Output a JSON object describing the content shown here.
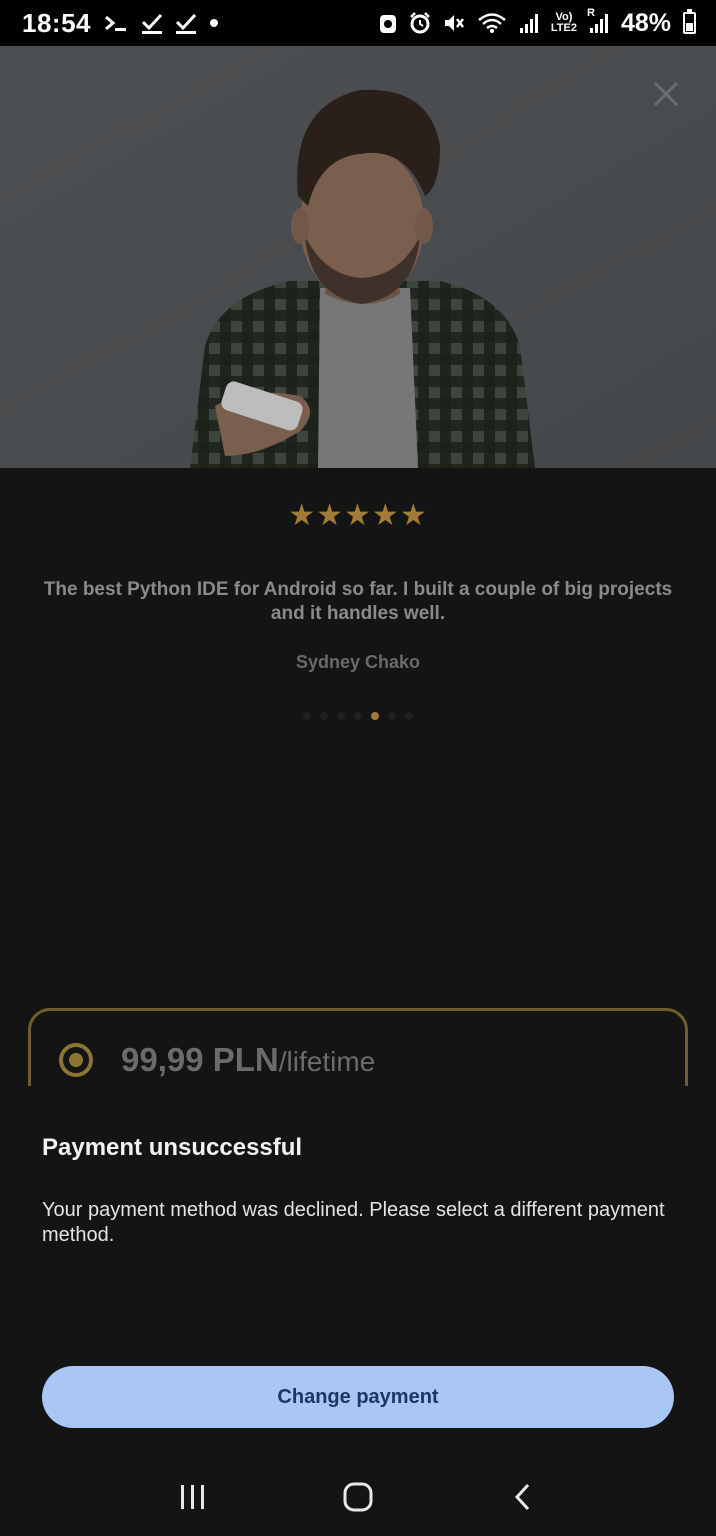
{
  "status_bar": {
    "time": "18:54",
    "left_icons": [
      "terminal-icon",
      "check-icon",
      "check-icon",
      "dot-icon"
    ],
    "volte_top": "Vo)",
    "volte_bottom": "LTE2",
    "roaming": "R",
    "battery": "48%"
  },
  "hero": {
    "image": "man-with-phone-photo",
    "close_icon": "close-icon"
  },
  "review": {
    "stars": "★★★★★",
    "rating": 5,
    "quote": "The best Python IDE for Android so far. I built a couple of big projects and it handles well.",
    "author": "Sydney Chako",
    "pager_total": 7,
    "pager_active": 5
  },
  "plan": {
    "price": "99,99 PLN",
    "period": "/lifetime",
    "selected": true
  },
  "dialog": {
    "title": "Payment unsuccessful",
    "message": "Your payment method was declined. Please select a different payment method.",
    "button_label": "Change payment"
  },
  "colors": {
    "accent_gold": "#a07d36",
    "button_bg": "#a9c6f4",
    "button_text": "#1f3565",
    "background": "#141414"
  }
}
